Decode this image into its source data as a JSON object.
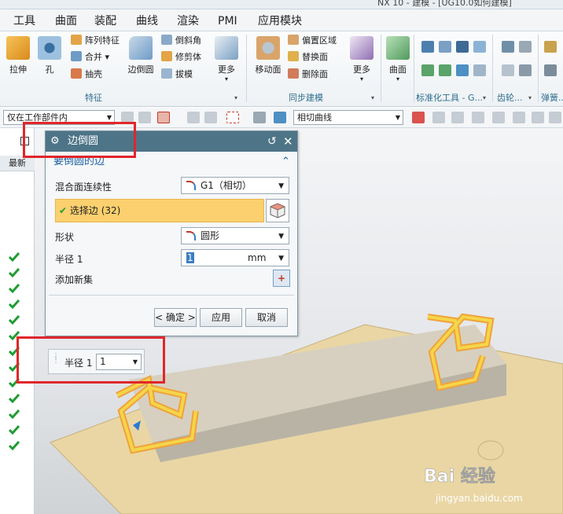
{
  "window": {
    "title": "NX 10 - 建模 - [UG10.0如何建模]"
  },
  "menu": [
    "工具",
    "曲面",
    "装配",
    "曲线",
    "渲染",
    "PMI",
    "应用模块"
  ],
  "ribbon": {
    "feature": {
      "extrude": "拉伸",
      "hole": "孔",
      "pattern": "阵列特征",
      "unite": "合并",
      "shell": "抽壳",
      "edge_blend": "边倒圆",
      "chamfer": "倒斜角",
      "trim_body": "修剪体",
      "draft": "拔模",
      "more": "更多",
      "group": "特征"
    },
    "sync": {
      "move_face": "移动面",
      "offset_region": "偏置区域",
      "replace_face": "替换面",
      "delete_face": "删除面",
      "more": "更多",
      "group": "同步建模"
    },
    "surface": {
      "label": "曲面"
    },
    "std_group": "标准化工具 - G...",
    "gear_group": "齿轮...",
    "spring_group": "弹簧..."
  },
  "toolbar2": {
    "filter": "仅在工作部件内",
    "curve_rule": "相切曲线"
  },
  "side": {
    "header": "最新",
    "checks": 13
  },
  "dialog": {
    "title": "边倒圆",
    "section": "要倒圆的边",
    "continuity_label": "混合面连续性",
    "continuity_value": "G1（相切）",
    "select_edge": "选择边 (32)",
    "shape_label": "形状",
    "shape_value": "圆形",
    "radius_label": "半径 1",
    "radius_value": "1",
    "radius_unit": "mm",
    "add_new_set": "添加新集",
    "ok": "< 确定 >",
    "apply": "应用",
    "cancel": "取消"
  },
  "radius_popup": {
    "label": "半径 1",
    "value": "1"
  },
  "watermark": {
    "brand": "Bai 经验",
    "url": "jingyan.baidu.com"
  }
}
